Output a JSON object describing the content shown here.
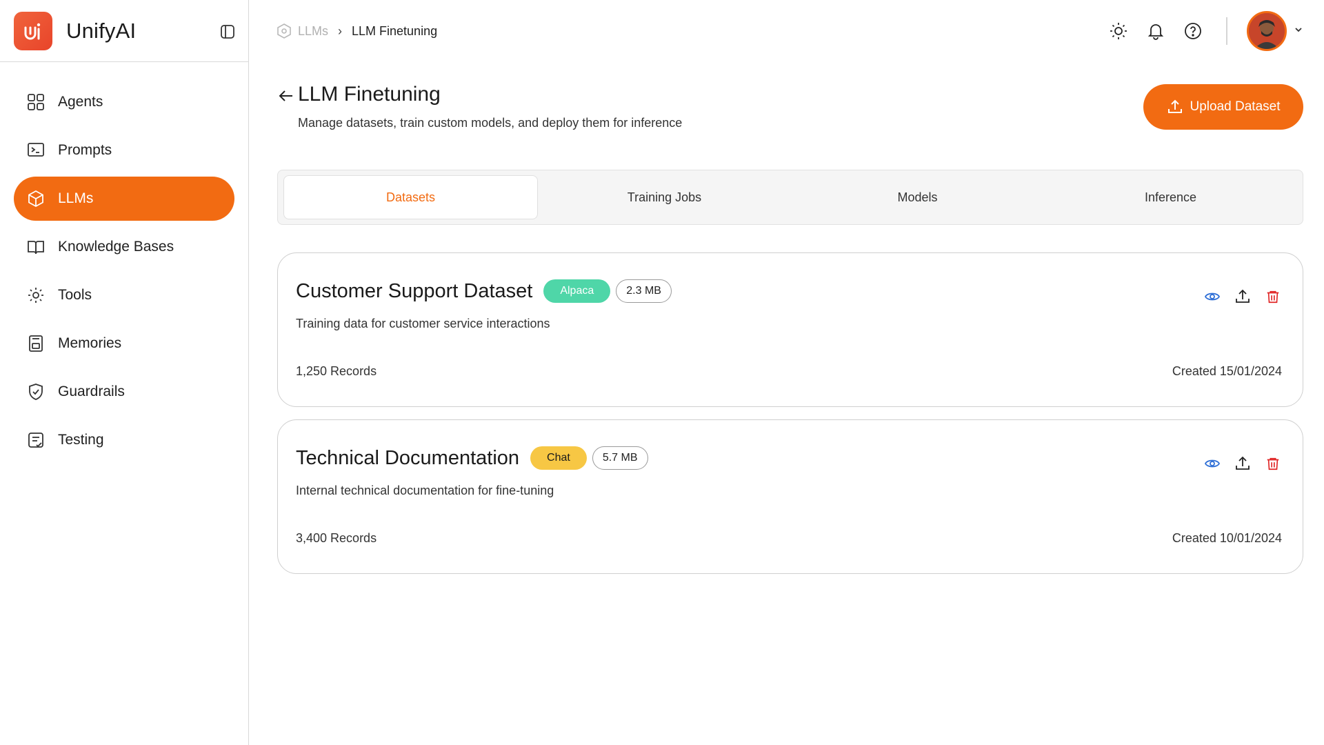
{
  "brand": {
    "name": "UnifyAI",
    "accent": "#f26b12"
  },
  "sidebar": {
    "items": [
      {
        "label": "Agents",
        "icon": "grid-icon"
      },
      {
        "label": "Prompts",
        "icon": "terminal-icon"
      },
      {
        "label": "LLMs",
        "icon": "cube-icon",
        "active": true
      },
      {
        "label": "Knowledge Bases",
        "icon": "book-icon"
      },
      {
        "label": "Tools",
        "icon": "gear-icon"
      },
      {
        "label": "Memories",
        "icon": "save-icon"
      },
      {
        "label": "Guardrails",
        "icon": "shield-icon"
      },
      {
        "label": "Testing",
        "icon": "checklist-icon"
      }
    ]
  },
  "breadcrumb": {
    "parent": "LLMs",
    "current": "LLM Finetuning"
  },
  "page": {
    "title": "LLM Finetuning",
    "subtitle": "Manage datasets, train custom models, and deploy them for inference",
    "upload_label": "Upload Dataset"
  },
  "tabs": [
    {
      "label": "Datasets",
      "active": true
    },
    {
      "label": "Training Jobs"
    },
    {
      "label": "Models"
    },
    {
      "label": "Inference"
    }
  ],
  "datasets": [
    {
      "title": "Customer Support Dataset",
      "format": "Alpaca",
      "size": "2.3 MB",
      "description": "Training data for customer service interactions",
      "records": "1,250 Records",
      "created": "Created 15/01/2024"
    },
    {
      "title": "Technical Documentation",
      "format": "Chat",
      "size": "5.7 MB",
      "description": "Internal technical documentation for fine-tuning",
      "records": "3,400 Records",
      "created": "Created 10/01/2024"
    }
  ]
}
